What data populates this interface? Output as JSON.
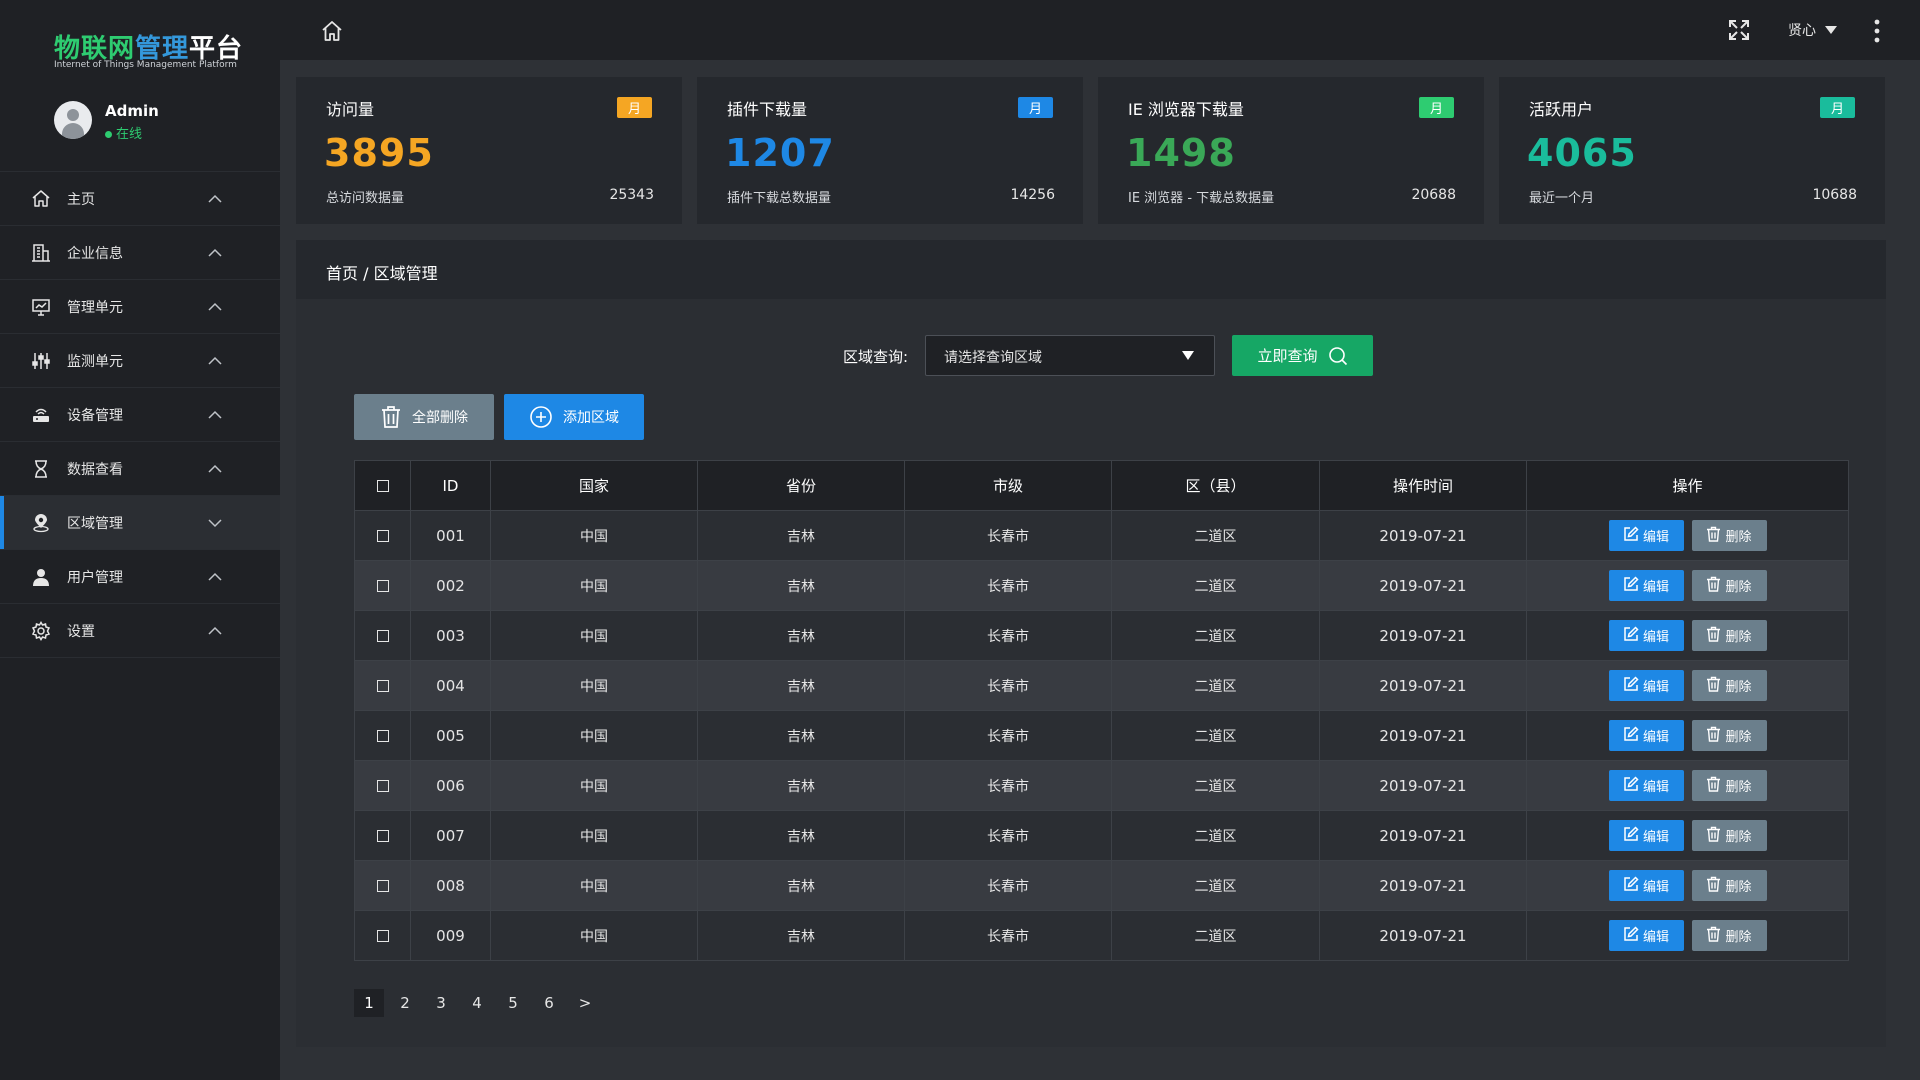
{
  "app": {
    "logo_part1": "物联网",
    "logo_part2": "管理",
    "logo_part3": "平台",
    "logo_subtitle": "Internet of Things Management Platform"
  },
  "user": {
    "name": "Admin",
    "status": "在线",
    "top_menu_label": "贤心"
  },
  "sidebar": {
    "items": [
      {
        "label": "主页",
        "icon": "home-icon"
      },
      {
        "label": "企业信息",
        "icon": "building-icon"
      },
      {
        "label": "管理单元",
        "icon": "monitor-chart-icon"
      },
      {
        "label": "监测单元",
        "icon": "sliders-icon"
      },
      {
        "label": "设备管理",
        "icon": "router-icon"
      },
      {
        "label": "数据查看",
        "icon": "hourglass-icon"
      },
      {
        "label": "区域管理",
        "icon": "location-pin-icon"
      },
      {
        "label": "用户管理",
        "icon": "user-icon"
      },
      {
        "label": "设置",
        "icon": "gear-icon"
      }
    ],
    "active_index": 6
  },
  "stats": [
    {
      "title": "访问量",
      "badge": "月",
      "value": "3895",
      "sublabel": "总访问数据量",
      "total": "25343",
      "value_color": "#f5a623",
      "badge_color": "#f5a623"
    },
    {
      "title": "插件下载量",
      "badge": "月",
      "value": "1207",
      "sublabel": "插件下载总数据量",
      "total": "14256",
      "value_color": "#1e88e5",
      "badge_color": "#1e88e5"
    },
    {
      "title": "IE 浏览器下载量",
      "badge": "月",
      "value": "1498",
      "sublabel": "IE 浏览器 - 下载总数据量",
      "total": "20688",
      "value_color": "#3aa857",
      "badge_color": "#2ecc71"
    },
    {
      "title": "活跃用户",
      "badge": "月",
      "value": "4065",
      "sublabel": "最近一个月",
      "total": "10688",
      "value_color": "#1abc9c",
      "badge_color": "#1abc9c"
    }
  ],
  "breadcrumb": "首页 / 区域管理",
  "query": {
    "label": "区域查询:",
    "select_value": "请选择查询区域",
    "button_label": "立即查询"
  },
  "actions": {
    "delete_all": "全部删除",
    "add_area": "添加区域"
  },
  "table": {
    "headers": [
      "ID",
      "国家",
      "省份",
      "市级",
      "区（县）",
      "操作时间",
      "操作"
    ],
    "edit_label": "编辑",
    "delete_label": "删除",
    "rows": [
      {
        "id": "001",
        "country": "中国",
        "province": "吉林",
        "city": "长春市",
        "district": "二道区",
        "time": "2019-07-21"
      },
      {
        "id": "002",
        "country": "中国",
        "province": "吉林",
        "city": "长春市",
        "district": "二道区",
        "time": "2019-07-21"
      },
      {
        "id": "003",
        "country": "中国",
        "province": "吉林",
        "city": "长春市",
        "district": "二道区",
        "time": "2019-07-21"
      },
      {
        "id": "004",
        "country": "中国",
        "province": "吉林",
        "city": "长春市",
        "district": "二道区",
        "time": "2019-07-21"
      },
      {
        "id": "005",
        "country": "中国",
        "province": "吉林",
        "city": "长春市",
        "district": "二道区",
        "time": "2019-07-21"
      },
      {
        "id": "006",
        "country": "中国",
        "province": "吉林",
        "city": "长春市",
        "district": "二道区",
        "time": "2019-07-21"
      },
      {
        "id": "007",
        "country": "中国",
        "province": "吉林",
        "city": "长春市",
        "district": "二道区",
        "time": "2019-07-21"
      },
      {
        "id": "008",
        "country": "中国",
        "province": "吉林",
        "city": "长春市",
        "district": "二道区",
        "time": "2019-07-21"
      },
      {
        "id": "009",
        "country": "中国",
        "province": "吉林",
        "city": "长春市",
        "district": "二道区",
        "time": "2019-07-21"
      }
    ]
  },
  "pagination": {
    "pages": [
      "1",
      "2",
      "3",
      "4",
      "5",
      "6"
    ],
    "next": ">",
    "current": "1"
  }
}
